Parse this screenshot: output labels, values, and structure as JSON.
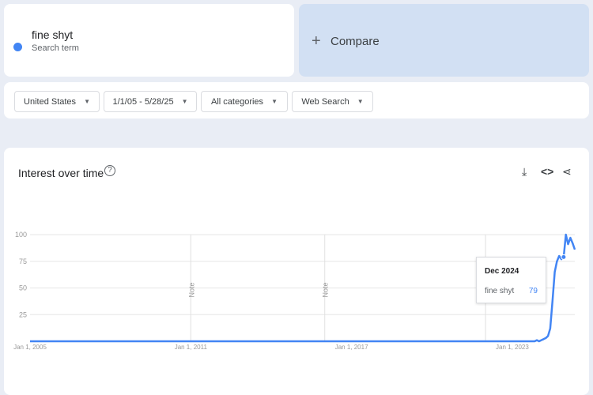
{
  "search_term": {
    "name": "fine shyt",
    "subtitle": "Search term",
    "color": "#4285f4"
  },
  "compare": {
    "icon": "plus-icon",
    "label": "Compare"
  },
  "filters": [
    {
      "label": "United States"
    },
    {
      "label": "1/1/05 - 5/28/25"
    },
    {
      "label": "All categories"
    },
    {
      "label": "Web Search"
    }
  ],
  "chart_header": {
    "title": "Interest over time",
    "icons": [
      "help-icon",
      "download-icon",
      "embed-icon",
      "share-icon"
    ]
  },
  "tooltip": {
    "date": "Dec 2024",
    "term": "fine shyt",
    "value": "79"
  },
  "chart_data": {
    "type": "line",
    "title": "Interest over time",
    "xlabel": "",
    "ylabel": "",
    "ylim": [
      0,
      100
    ],
    "yticks": [
      "25",
      "50",
      "75",
      "100"
    ],
    "xticks": [
      "Jan 1, 2005",
      "Jan 1, 2011",
      "Jan 1, 2017",
      "Jan 1, 2023"
    ],
    "xlim": [
      "2005-01",
      "2025-05"
    ],
    "grid": true,
    "notes": [
      {
        "label": "Note",
        "date": "2011-01"
      },
      {
        "label": "Note",
        "date": "2016-01"
      },
      {
        "label": "",
        "date": "2022-01"
      }
    ],
    "series": [
      {
        "name": "fine shyt",
        "color": "#4285f4",
        "points": [
          [
            "2005-01",
            0
          ],
          [
            "2023-10",
            0
          ],
          [
            "2023-11",
            0
          ],
          [
            "2023-12",
            1
          ],
          [
            "2024-01",
            0
          ],
          [
            "2024-02",
            1
          ],
          [
            "2024-03",
            2
          ],
          [
            "2024-04",
            3
          ],
          [
            "2024-05",
            5
          ],
          [
            "2024-06",
            12
          ],
          [
            "2024-07",
            38
          ],
          [
            "2024-08",
            65
          ],
          [
            "2024-09",
            75
          ],
          [
            "2024-10",
            80
          ],
          [
            "2024-11",
            77
          ],
          [
            "2024-12",
            79
          ],
          [
            "2025-01",
            100
          ],
          [
            "2025-02",
            91
          ],
          [
            "2025-03",
            97
          ],
          [
            "2025-04",
            92
          ],
          [
            "2025-05",
            86
          ]
        ]
      }
    ]
  }
}
